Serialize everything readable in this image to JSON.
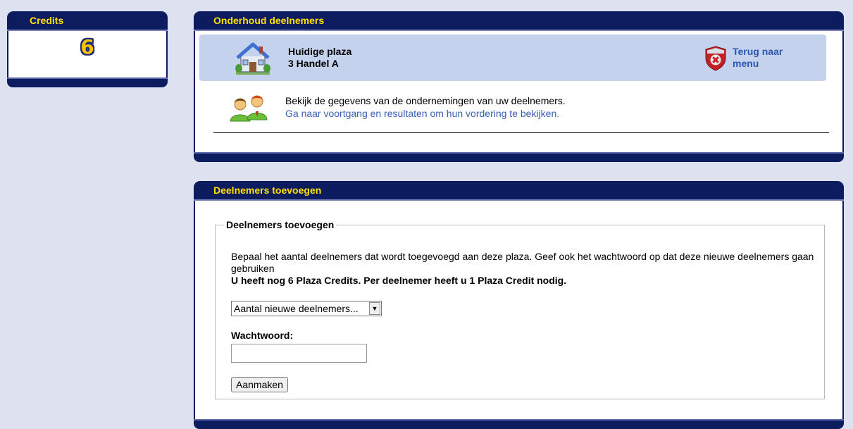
{
  "credits": {
    "title": "Credits",
    "value": "6"
  },
  "onderhoud": {
    "title": "Onderhoud deelnemers",
    "plaza_label": "Huidige plaza",
    "plaza_name": "3 Handel A",
    "back_link": "Terug naar menu",
    "info_line": "Bekijk de gegevens van de ondernemingen van uw deelnemers.",
    "progress_link": "Ga naar voortgang en resultaten om hun vordering te bekijken.",
    "icons": {
      "house": "house-icon",
      "back": "shield-x-icon",
      "people": "people-icon"
    }
  },
  "toevoegen": {
    "title": "Deelnemers toevoegen",
    "legend": "Deelnemers toevoegen",
    "description": "Bepaal het aantal deelnemers dat wordt toegevoegd aan deze plaza. Geef ook het wachtwoord op dat deze nieuwe deelnemers gaan gebruiken",
    "credits_note": "U heeft nog 6 Plaza Credits. Per deelnemer heeft u 1 Plaza Credit nodig.",
    "select_value": "Aantal nieuwe deelnemers...",
    "password_label": "Wachtwoord:",
    "password_value": "",
    "submit_label": "Aanmaken"
  },
  "colors": {
    "header_bg": "#0d1c5f",
    "header_text": "#ffe000",
    "page_bg": "#dde1f0",
    "plaza_bar": "#c5d2ee",
    "link": "#2a58b0"
  }
}
